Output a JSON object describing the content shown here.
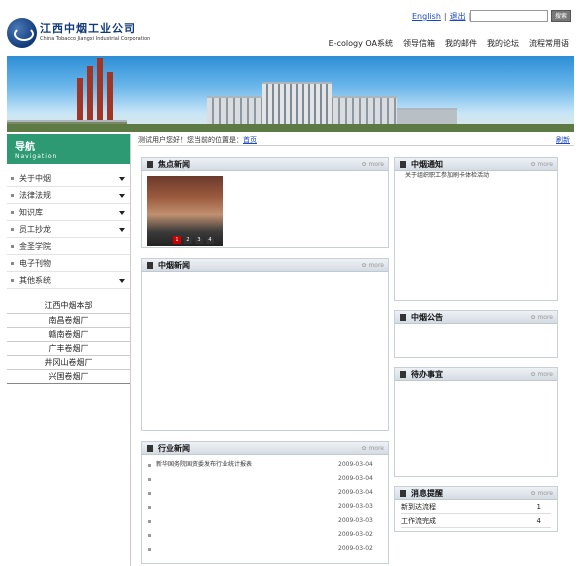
{
  "header": {
    "company_cn": "江西中烟工业公司",
    "company_en": "China Tobacco Jiangxi Industrial Corporation",
    "links": {
      "english": "English",
      "logout": "退出"
    },
    "search_button": "搜索",
    "nav": [
      "E-cology OA系统",
      "领导信箱",
      "我的邮件",
      "我的论坛",
      "流程常用语"
    ]
  },
  "sidebar": {
    "title": "导航",
    "subtitle": "Navigation",
    "items": [
      {
        "label": "关于中烟",
        "arrow": true
      },
      {
        "label": "法律法规",
        "arrow": true
      },
      {
        "label": "知识库",
        "arrow": true
      },
      {
        "label": "员工抄龙",
        "arrow": true
      },
      {
        "label": "金圣学院",
        "arrow": false
      },
      {
        "label": "电子刊物",
        "arrow": false
      },
      {
        "label": "其他系统",
        "arrow": true
      }
    ],
    "org_title": "江西中烟本部",
    "orgs": [
      "南昌卷烟厂",
      "赣南卷烟厂",
      "广丰卷烟厂",
      "井冈山卷烟厂",
      "兴国卷烟厂"
    ]
  },
  "status_bar": {
    "greeting": "测试用户您好！您当前的位置是：",
    "location": "首页",
    "refresh": "刷新"
  },
  "panels": {
    "focus": {
      "title": "焦点新闻",
      "more": "more",
      "photo_pages": [
        "1",
        "2",
        "3",
        "4"
      ]
    },
    "company_news": {
      "title": "中烟新闻",
      "more": "more"
    },
    "industry_news": {
      "title": "行业新闻",
      "more": "more",
      "first_item": "新华国务院国资委发布行业统计报表",
      "first_date": "2009-03-04",
      "dates": [
        "2009-03-04",
        "2009-03-04",
        "2009-03-03",
        "2009-03-03",
        "2009-03-02",
        "2009-03-02"
      ]
    },
    "notice": {
      "title": "中烟通知",
      "more": "more",
      "item": "关于组织职工参加刷卡体检活动"
    },
    "bulletin": {
      "title": "中烟公告",
      "more": "more"
    },
    "todo": {
      "title": "待办事宜",
      "more": "more"
    },
    "messages": {
      "title": "消息提醒",
      "more": "more",
      "rows": [
        {
          "label": "新到达流程",
          "value": "1"
        },
        {
          "label": "工作流完成",
          "value": "4"
        }
      ]
    }
  }
}
